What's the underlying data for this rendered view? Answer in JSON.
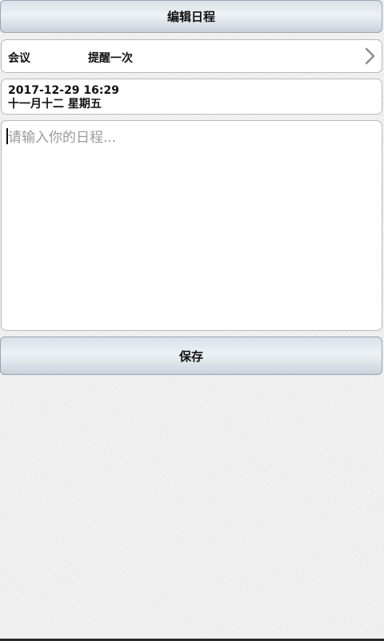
{
  "header": {
    "title": "编辑日程"
  },
  "schedule": {
    "type_label": "会议",
    "remind_label": "提醒一次",
    "date_time": "2017-12-29 16:29",
    "lunar_date": "十一月十二 星期五"
  },
  "editor": {
    "placeholder": "请输入你的日程...",
    "value": ""
  },
  "actions": {
    "save_label": "保存"
  },
  "icons": {
    "chevron": "chevron-right-icon"
  }
}
